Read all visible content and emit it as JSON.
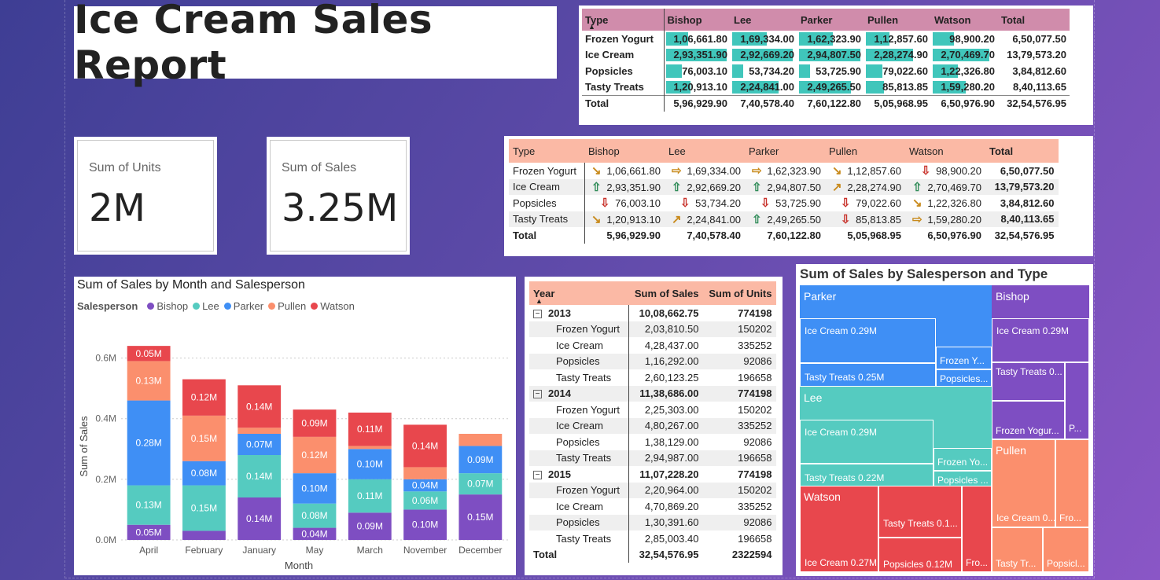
{
  "title": "Ice Cream Sales Report",
  "cards": [
    {
      "label": "Sum of Units",
      "value": "2M"
    },
    {
      "label": "Sum of Sales",
      "value": "3.25M"
    }
  ],
  "matrix_bars": {
    "headers": [
      "Type",
      "Bishop",
      "Lee",
      "Parker",
      "Pullen",
      "Watson",
      "Total"
    ],
    "rows": [
      {
        "type": "Frozen Yogurt",
        "cells": [
          "1,06,661.80",
          "1,69,334.00",
          "1,62,323.90",
          "1,12,857.60",
          "98,900.20"
        ],
        "fills": [
          0.36,
          0.57,
          0.55,
          0.38,
          0.34
        ],
        "total": "6,50,077.50"
      },
      {
        "type": "Ice Cream",
        "cells": [
          "2,93,351.90",
          "2,92,669.20",
          "2,94,807.50",
          "2,28,274.90",
          "2,70,469.70"
        ],
        "fills": [
          0.99,
          0.99,
          1.0,
          0.77,
          0.92
        ],
        "total": "13,79,573.20"
      },
      {
        "type": "Popsicles",
        "cells": [
          "76,003.10",
          "53,734.20",
          "53,725.90",
          "79,022.60",
          "1,22,326.80"
        ],
        "fills": [
          0.26,
          0.18,
          0.18,
          0.27,
          0.41
        ],
        "total": "3,84,812.60"
      },
      {
        "type": "Tasty Treats",
        "cells": [
          "1,20,913.10",
          "2,24,841.00",
          "2,49,265.50",
          "85,813.85",
          "1,59,280.20"
        ],
        "fills": [
          0.41,
          0.76,
          0.85,
          0.29,
          0.54
        ],
        "total": "8,40,113.65"
      }
    ],
    "total": {
      "type": "Total",
      "cells": [
        "5,96,929.90",
        "7,40,578.40",
        "7,60,122.80",
        "5,05,968.95",
        "6,50,976.90"
      ],
      "total": "32,54,576.95"
    }
  },
  "matrix_arrows": {
    "headers": [
      "Type",
      "Bishop",
      "Lee",
      "Parker",
      "Pullen",
      "Watson",
      "Total"
    ],
    "rows": [
      {
        "type": "Frozen Yogurt",
        "cells": [
          "1,06,661.80",
          "1,69,334.00",
          "1,62,323.90",
          "1,12,857.60",
          "98,900.20"
        ],
        "arrows": [
          "dr",
          "rt",
          "rt",
          "dr",
          "dn"
        ],
        "total": "6,50,077.50"
      },
      {
        "type": "Ice Cream",
        "cells": [
          "2,93,351.90",
          "2,92,669.20",
          "2,94,807.50",
          "2,28,274.90",
          "2,70,469.70"
        ],
        "arrows": [
          "up",
          "up",
          "up",
          "ur",
          "up"
        ],
        "total": "13,79,573.20"
      },
      {
        "type": "Popsicles",
        "cells": [
          "76,003.10",
          "53,734.20",
          "53,725.90",
          "79,022.60",
          "1,22,326.80"
        ],
        "arrows": [
          "dn",
          "dn",
          "dn",
          "dn",
          "dr"
        ],
        "total": "3,84,812.60"
      },
      {
        "type": "Tasty Treats",
        "cells": [
          "1,20,913.10",
          "2,24,841.00",
          "2,49,265.50",
          "85,813.85",
          "1,59,280.20"
        ],
        "arrows": [
          "dr",
          "ur",
          "up",
          "dn",
          "rt"
        ],
        "total": "8,40,113.65"
      }
    ],
    "total": {
      "type": "Total",
      "cells": [
        "5,96,929.90",
        "7,40,578.40",
        "7,60,122.80",
        "5,05,968.95",
        "6,50,976.90"
      ],
      "total": "32,54,576.95"
    }
  },
  "year_table": {
    "headers": [
      "Year",
      "Sum of Sales",
      "Sum of Units"
    ],
    "groups": [
      {
        "year": "2013",
        "sales": "10,08,662.75",
        "units": "774198",
        "rows": [
          {
            "type": "Frozen Yogurt",
            "sales": "2,03,810.50",
            "units": "150202"
          },
          {
            "type": "Ice Cream",
            "sales": "4,28,437.00",
            "units": "335252"
          },
          {
            "type": "Popsicles",
            "sales": "1,16,292.00",
            "units": "92086"
          },
          {
            "type": "Tasty Treats",
            "sales": "2,60,123.25",
            "units": "196658"
          }
        ]
      },
      {
        "year": "2014",
        "sales": "11,38,686.00",
        "units": "774198",
        "rows": [
          {
            "type": "Frozen Yogurt",
            "sales": "2,25,303.00",
            "units": "150202"
          },
          {
            "type": "Ice Cream",
            "sales": "4,80,267.00",
            "units": "335252"
          },
          {
            "type": "Popsicles",
            "sales": "1,38,129.00",
            "units": "92086"
          },
          {
            "type": "Tasty Treats",
            "sales": "2,94,987.00",
            "units": "196658"
          }
        ]
      },
      {
        "year": "2015",
        "sales": "11,07,228.20",
        "units": "774198",
        "rows": [
          {
            "type": "Frozen Yogurt",
            "sales": "2,20,964.00",
            "units": "150202"
          },
          {
            "type": "Ice Cream",
            "sales": "4,70,869.20",
            "units": "335252"
          },
          {
            "type": "Popsicles",
            "sales": "1,30,391.60",
            "units": "92086"
          },
          {
            "type": "Tasty Treats",
            "sales": "2,85,003.40",
            "units": "196658"
          }
        ]
      }
    ],
    "total": {
      "label": "Total",
      "sales": "32,54,576.95",
      "units": "2322594"
    }
  },
  "colors": {
    "Bishop": "#7e4ec2",
    "Lee": "#55cbc0",
    "Parker": "#3f8ff5",
    "Pullen": "#fb8f6d",
    "Watson": "#e8474d",
    "teal_bar": "#40c6bb",
    "header_pink": "#d08cab",
    "header_salmon": "#fbb9a5"
  },
  "chart_data": [
    {
      "type": "bar",
      "stacked": true,
      "title": "Sum of Sales by Month and Salesperson",
      "legend_title": "Salesperson",
      "xlabel": "Month",
      "ylabel": "Sum of Sales",
      "ylim": [
        0,
        0.7
      ],
      "yticks": [
        "0.0M",
        "0.2M",
        "0.4M",
        "0.6M"
      ],
      "ytick_values": [
        0,
        0.2,
        0.4,
        0.6
      ],
      "grid": true,
      "categories": [
        "April",
        "February",
        "January",
        "May",
        "March",
        "November",
        "December"
      ],
      "series": [
        {
          "name": "Bishop",
          "values": [
            0.05,
            0.03,
            0.14,
            0.04,
            0.09,
            0.1,
            0.15
          ],
          "labels": [
            "0.05M",
            "",
            "0.14M",
            "0.04M",
            "0.09M",
            "0.10M",
            "0.15M"
          ]
        },
        {
          "name": "Lee",
          "values": [
            0.13,
            0.15,
            0.14,
            0.08,
            0.11,
            0.06,
            0.07
          ],
          "labels": [
            "0.13M",
            "0.15M",
            "0.14M",
            "0.08M",
            "0.11M",
            "0.06M",
            "0.07M"
          ]
        },
        {
          "name": "Parker",
          "values": [
            0.28,
            0.08,
            0.07,
            0.1,
            0.1,
            0.04,
            0.09
          ],
          "labels": [
            "0.28M",
            "0.08M",
            "0.07M",
            "0.10M",
            "0.10M",
            "0.04M",
            "0.09M"
          ]
        },
        {
          "name": "Pullen",
          "values": [
            0.13,
            0.15,
            0.02,
            0.12,
            0.01,
            0.04,
            0.04
          ],
          "labels": [
            "0.13M",
            "0.15M",
            "",
            "0.12M",
            "",
            "",
            ""
          ]
        },
        {
          "name": "Watson",
          "values": [
            0.05,
            0.12,
            0.14,
            0.09,
            0.11,
            0.14,
            0.0
          ],
          "labels": [
            "0.05M",
            "0.12M",
            "0.14M",
            "0.09M",
            "0.11M",
            "0.14M",
            ""
          ]
        }
      ]
    },
    {
      "type": "treemap",
      "title": "Sum of Sales by Salesperson and Type",
      "groups": [
        {
          "name": "Parker",
          "items": [
            {
              "label": "Ice Cream 0.29M"
            },
            {
              "label": "Tasty Treats 0.25M"
            },
            {
              "label": "Frozen Y..."
            },
            {
              "label": "Popsicles..."
            }
          ]
        },
        {
          "name": "Lee",
          "items": [
            {
              "label": "Ice Cream 0.29M"
            },
            {
              "label": "Tasty Treats 0.22M"
            },
            {
              "label": "Frozen Yo..."
            },
            {
              "label": "Popsicles ..."
            }
          ]
        },
        {
          "name": "Watson",
          "items": [
            {
              "label": "Ice Cream 0.27M"
            },
            {
              "label": "Tasty Treats 0.1..."
            },
            {
              "label": "Popsicles 0.12M"
            },
            {
              "label": "Fro..."
            }
          ]
        },
        {
          "name": "Bishop",
          "items": [
            {
              "label": "Ice Cream 0.29M"
            },
            {
              "label": "Tasty Treats 0..."
            },
            {
              "label": "Frozen Yogur..."
            },
            {
              "label": "P..."
            }
          ]
        },
        {
          "name": "Pullen",
          "items": [
            {
              "label": "Ice Cream 0..."
            },
            {
              "label": "Fro..."
            },
            {
              "label": "Tasty Tr..."
            },
            {
              "label": "Popsicl..."
            }
          ]
        }
      ]
    }
  ]
}
